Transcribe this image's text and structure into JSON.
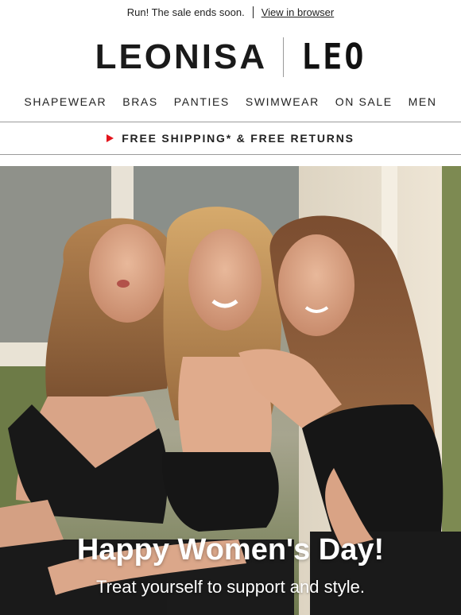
{
  "preheader": {
    "text": "Run! The sale ends soon.",
    "link": "View in browser"
  },
  "logo": {
    "main": "LEONISA",
    "secondary": "LEO"
  },
  "nav": {
    "items": [
      "SHAPEWEAR",
      "BRAS",
      "PANTIES",
      "SWIMWEAR",
      "ON SALE",
      "MEN"
    ]
  },
  "shipping": {
    "text": "FREE SHIPPING* & FREE RETURNS",
    "arrow_color": "#e3141c"
  },
  "hero": {
    "title": "Happy Women's Day!",
    "subtitle": "Treat yourself to support and style."
  }
}
